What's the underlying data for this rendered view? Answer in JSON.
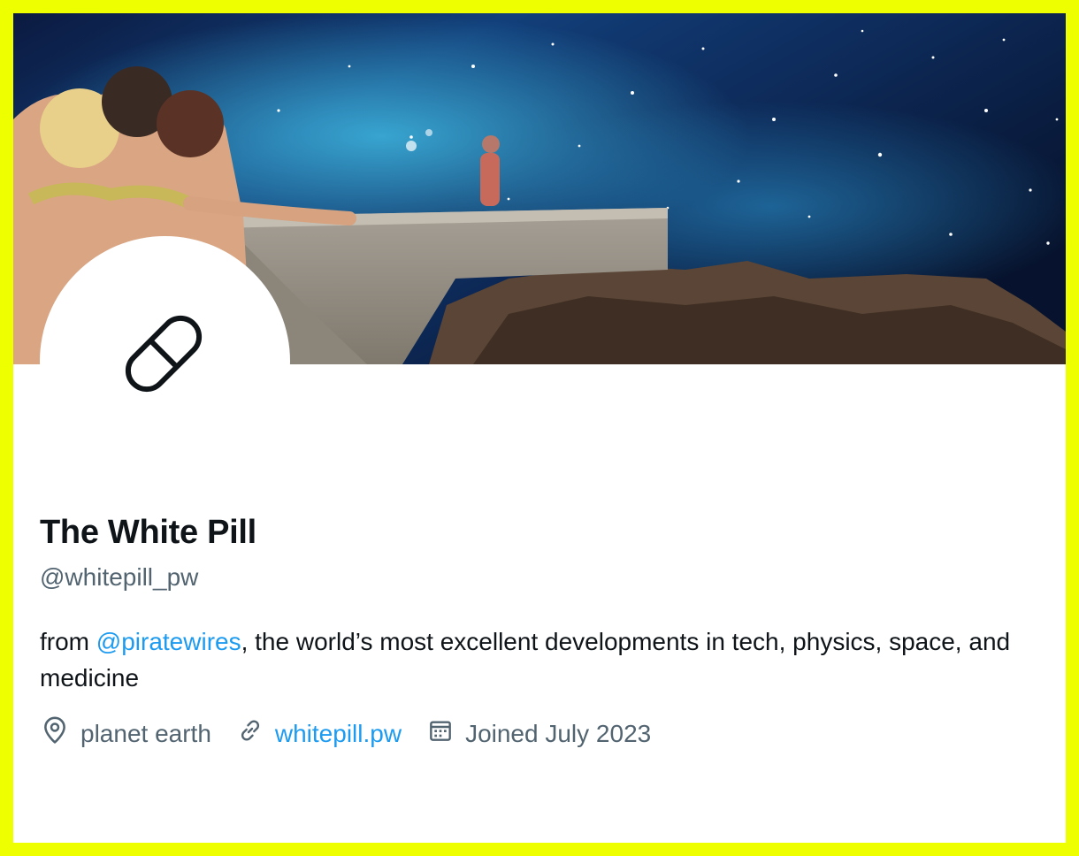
{
  "profile": {
    "display_name": "The White Pill",
    "handle": "@whitepill_pw",
    "bio": {
      "prefix": "from ",
      "mention": "@piratewires",
      "suffix": ", the world’s most excellent developments in tech, physics, space, and medicine"
    },
    "location": "planet earth",
    "website": "whitepill.pw",
    "joined": "Joined July 2023"
  },
  "icons": {
    "avatar": "pill-icon",
    "location": "location-pin-icon",
    "website": "link-icon",
    "joined": "calendar-icon"
  },
  "colors": {
    "border": "#eeff00",
    "background": "#ffffff",
    "text_primary": "#0f1419",
    "text_secondary": "#536471",
    "link": "#1d9bf0"
  }
}
